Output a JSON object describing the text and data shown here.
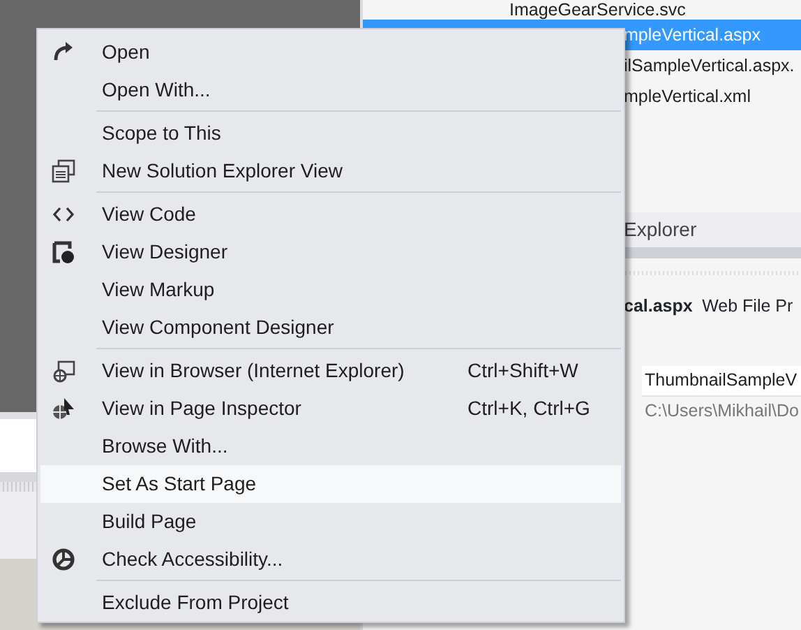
{
  "solution_explorer": {
    "items": [
      {
        "label": "ImageGearService.svc",
        "selected": false
      },
      {
        "label": "mpleVertical.aspx",
        "selected": true
      },
      {
        "label": "ilSampleVertical.aspx.",
        "selected": false
      },
      {
        "label": "mpleVertical.xml",
        "selected": false
      }
    ],
    "tab_label": "Explorer"
  },
  "properties": {
    "file_name": "cal.aspx",
    "file_type": "Web File Pr",
    "name_value": "ThumbnailSampleV",
    "path_value": "C:\\Users\\Mikhail\\Do"
  },
  "context_menu": {
    "items": [
      {
        "kind": "item",
        "label": "Open",
        "highlighted": false
      },
      {
        "kind": "item",
        "label": "Open With...",
        "highlighted": false
      },
      {
        "kind": "separator"
      },
      {
        "kind": "item",
        "label": "Scope to This",
        "highlighted": false
      },
      {
        "kind": "item",
        "label": "New Solution Explorer View",
        "highlighted": false
      },
      {
        "kind": "separator"
      },
      {
        "kind": "item",
        "label": "View Code",
        "highlighted": false
      },
      {
        "kind": "item",
        "label": "View Designer",
        "highlighted": false
      },
      {
        "kind": "item",
        "label": "View Markup",
        "highlighted": false
      },
      {
        "kind": "item",
        "label": "View Component Designer",
        "highlighted": false
      },
      {
        "kind": "separator"
      },
      {
        "kind": "item",
        "label": "View in Browser (Internet Explorer)",
        "shortcut": "Ctrl+Shift+W",
        "highlighted": false
      },
      {
        "kind": "item",
        "label": "View in Page Inspector",
        "shortcut": "Ctrl+K, Ctrl+G",
        "highlighted": false
      },
      {
        "kind": "item",
        "label": "Browse With...",
        "highlighted": false
      },
      {
        "kind": "item",
        "label": "Set As Start Page",
        "highlighted": true
      },
      {
        "kind": "item",
        "label": "Build Page",
        "highlighted": false
      },
      {
        "kind": "item",
        "label": "Check Accessibility...",
        "highlighted": false
      },
      {
        "kind": "separator"
      },
      {
        "kind": "item",
        "label": "Exclude From Project",
        "highlighted": false
      }
    ]
  }
}
